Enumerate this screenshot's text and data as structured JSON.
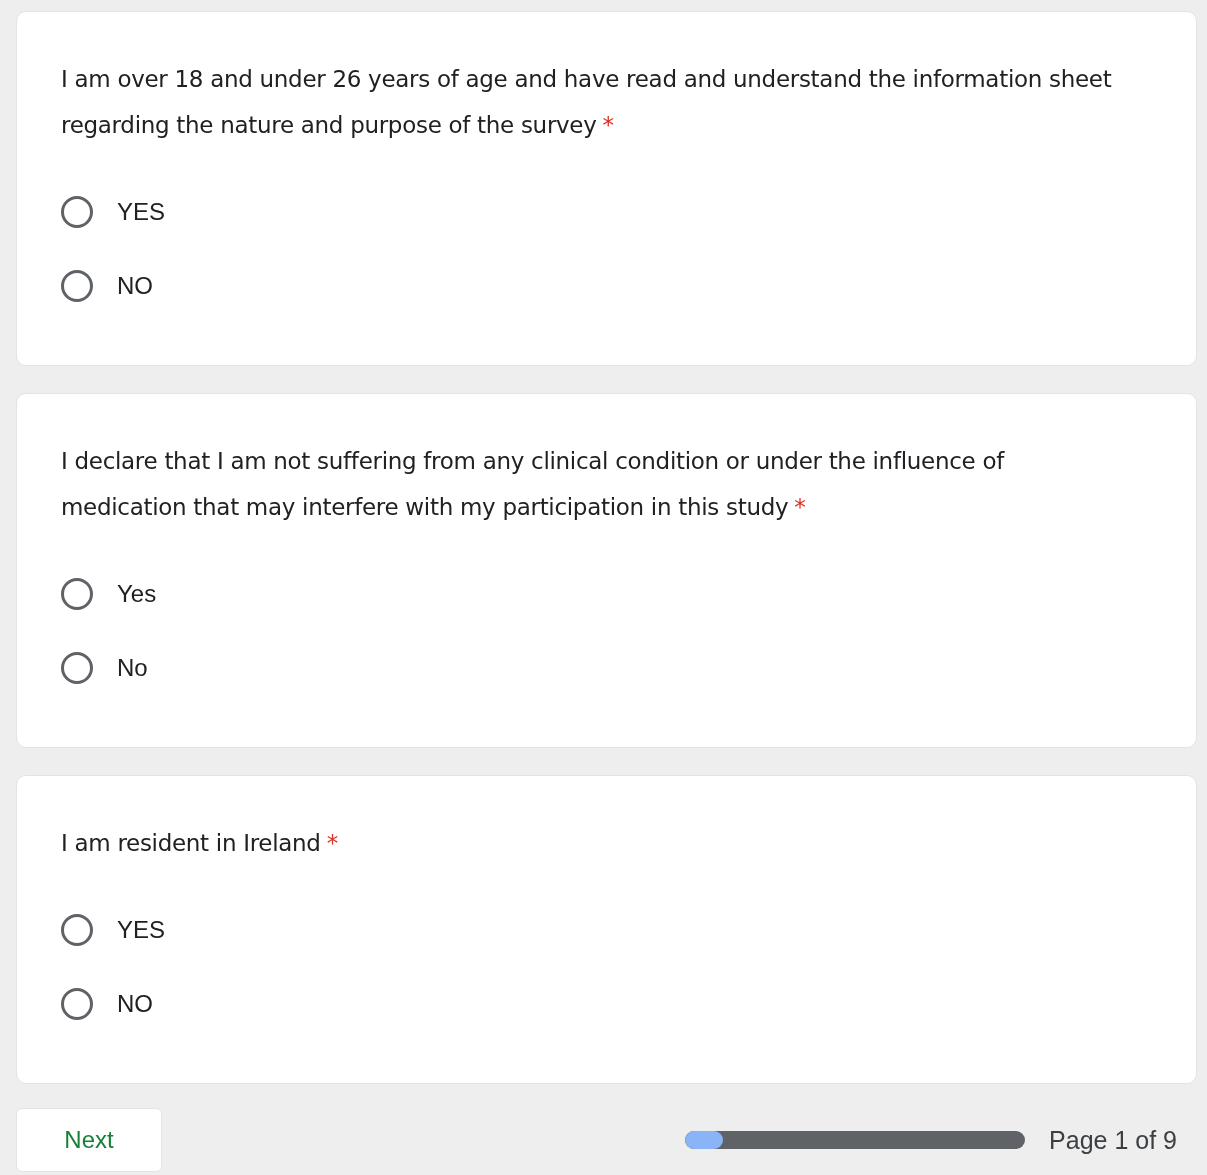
{
  "questions": [
    {
      "text": "I am over 18 and under 26 years of age and have read and understand the information sheet regarding the nature and purpose of the survey",
      "required_mark": "*",
      "options": [
        {
          "label": "YES",
          "selected": false
        },
        {
          "label": "NO",
          "selected": false
        }
      ]
    },
    {
      "text": "I declare that I am not suffering from any clinical condition or under the influence of medication that may interfere with my participation in this study",
      "required_mark": "*",
      "options": [
        {
          "label": "Yes",
          "selected": false
        },
        {
          "label": "No",
          "selected": false
        }
      ]
    },
    {
      "text": "I am resident in Ireland",
      "required_mark": "*",
      "options": [
        {
          "label": "YES",
          "selected": false
        },
        {
          "label": "NO",
          "selected": false
        }
      ]
    }
  ],
  "footer": {
    "next_button": "Next",
    "progress": {
      "level": 0.11
    },
    "page_label": "Page 1 of 9"
  }
}
